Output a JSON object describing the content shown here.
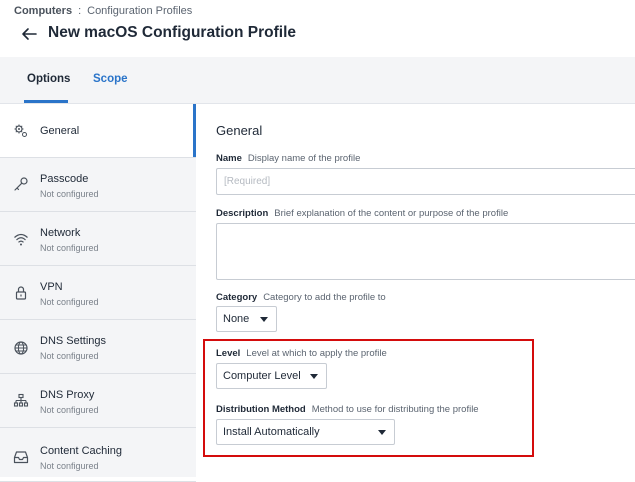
{
  "breadcrumb": {
    "root": "Computers",
    "separator": ":",
    "current": "Configuration Profiles"
  },
  "page": {
    "title": "New macOS Configuration Profile"
  },
  "tabs": [
    {
      "label": "Options",
      "active": true
    },
    {
      "label": "Scope",
      "active": false
    }
  ],
  "sidebar": {
    "items": [
      {
        "label": "General",
        "status": "",
        "icon": "gear-icon"
      },
      {
        "label": "Passcode",
        "status": "Not configured",
        "icon": "key-icon"
      },
      {
        "label": "Network",
        "status": "Not configured",
        "icon": "wifi-icon"
      },
      {
        "label": "VPN",
        "status": "Not configured",
        "icon": "lock-icon"
      },
      {
        "label": "DNS Settings",
        "status": "Not configured",
        "icon": "globe-icon"
      },
      {
        "label": "DNS Proxy",
        "status": "Not configured",
        "icon": "network-tree-icon"
      },
      {
        "label": "Content Caching",
        "status": "Not configured",
        "icon": "inbox-icon"
      }
    ]
  },
  "general": {
    "title": "General",
    "name": {
      "label": "Name",
      "hint": "Display name of the profile",
      "placeholder": "[Required]"
    },
    "description": {
      "label": "Description",
      "hint": "Brief explanation of the content or purpose of the profile"
    },
    "category": {
      "label": "Category",
      "hint": "Category to add the profile to",
      "value": "None"
    },
    "level": {
      "label": "Level",
      "hint": "Level at which to apply the profile",
      "value": "Computer Level"
    },
    "distribution": {
      "label": "Distribution Method",
      "hint": "Method to use for distributing the profile",
      "value": "Install Automatically"
    }
  },
  "colors": {
    "accent": "#2a74c9",
    "highlight": "#d40c0c",
    "sidebar_bg": "#f4f5f7"
  }
}
